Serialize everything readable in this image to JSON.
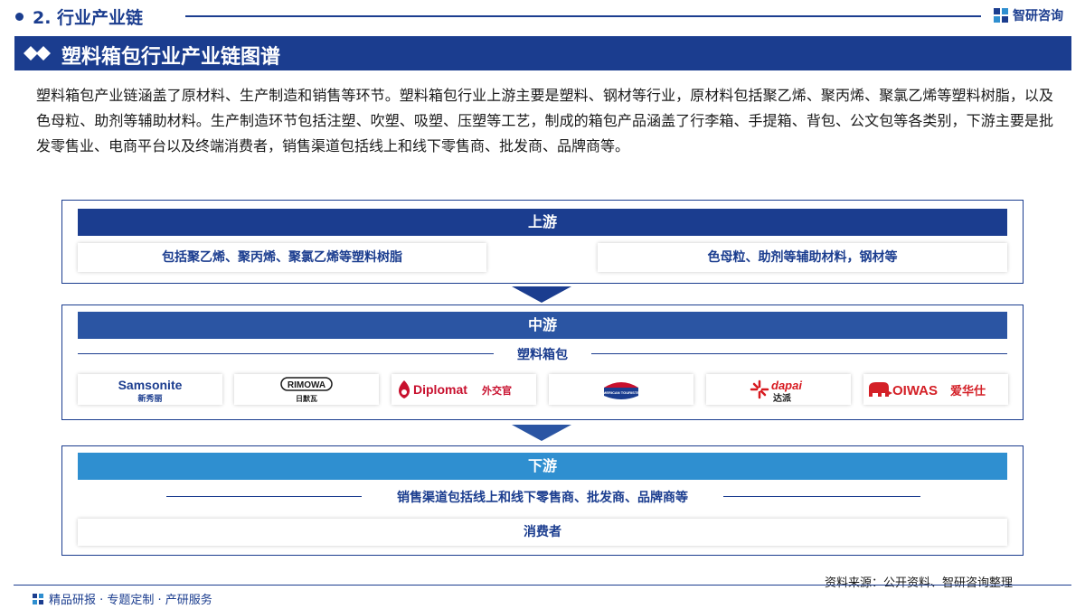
{
  "header": {
    "section_label": "2. 行业产业链",
    "brand": "智研咨询"
  },
  "title": "塑料箱包行业产业链图谱",
  "intro": "塑料箱包产业链涵盖了原材料、生产制造和销售等环节。塑料箱包行业上游主要是塑料、钢材等行业，原材料包括聚乙烯、聚丙烯、聚氯乙烯等塑料树脂，以及色母粒、助剂等辅助材料。生产制造环节包括注塑、吹塑、吸塑、压塑等工艺，制成的箱包产品涵盖了行李箱、手提箱、背包、公文包等各类别，下游主要是批发零售业、电商平台以及终端消费者，销售渠道包括线上和线下零售商、批发商、品牌商等。",
  "upstream": {
    "label": "上游",
    "left": "包括聚乙烯、聚丙烯、聚氯乙烯等塑料树脂",
    "right": "色母粒、助剂等辅助材料，钢材等"
  },
  "midstream": {
    "label": "中游",
    "product": "塑料箱包",
    "brands": [
      {
        "name": "Samsonite",
        "cn": "新秀丽",
        "icon": "samsonite-logo"
      },
      {
        "name": "RIMOWA",
        "cn": "日默瓦",
        "icon": "rimowa-logo"
      },
      {
        "name": "Diplomat",
        "cn": "外交官",
        "icon": "diplomat-logo"
      },
      {
        "name": "AMERICAN TOURISTER",
        "cn": "",
        "icon": "american-tourister-logo"
      },
      {
        "name": "dapai",
        "cn": "达派",
        "icon": "dapai-logo"
      },
      {
        "name": "OIWAS",
        "cn": "爱华仕",
        "icon": "oiwas-logo"
      }
    ]
  },
  "downstream": {
    "label": "下游",
    "channels": "销售渠道包括线上和线下零售商、批发商、品牌商等",
    "consumer": "消费者"
  },
  "footer": {
    "source": "资料来源：公开资料、智研咨询整理",
    "tagline": "精品研报 · 专题定制 · 产研服务"
  },
  "colors": {
    "primary": "#1b3d8f",
    "mid_band": "#2b55a3",
    "down_band": "#2f8fd0",
    "diplomat_red": "#c8102e",
    "dapai_red": "#d7191f",
    "oiwas_red": "#d42027"
  }
}
